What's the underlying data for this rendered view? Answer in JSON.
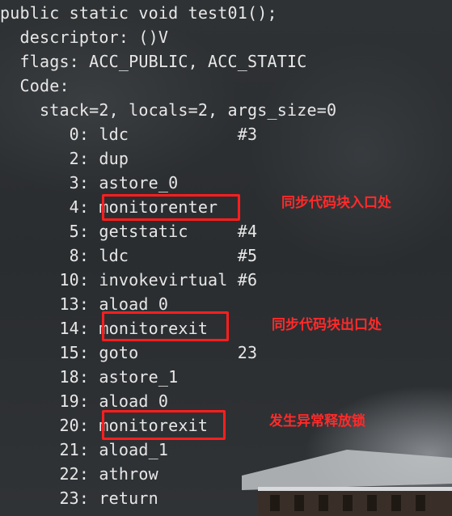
{
  "lines": [
    "public static void test01();",
    "  descriptor: ()V",
    "  flags: ACC_PUBLIC, ACC_STATIC",
    "  Code:",
    "    stack=2, locals=2, args_size=0",
    "       0: ldc           #3",
    "       2: dup",
    "       3: astore_0",
    "       4: monitorenter",
    "       5: getstatic     #4",
    "       8: ldc           #5",
    "      10: invokevirtual #6",
    "      13: aload_0",
    "      14: monitorexit",
    "      15: goto          23",
    "      18: astore_1",
    "      19: aload_0",
    "      20: monitorexit",
    "      21: aload_1",
    "      22: athrow",
    "      23: return"
  ],
  "annotations": {
    "sync_entry": "同步代码块入口处",
    "sync_exit": "同步代码块出口处",
    "exception_release": "发生异常释放锁"
  },
  "colors": {
    "code_text": "#e7e7e7",
    "highlight": "#ff1e1e",
    "background": "#2b2e31"
  }
}
